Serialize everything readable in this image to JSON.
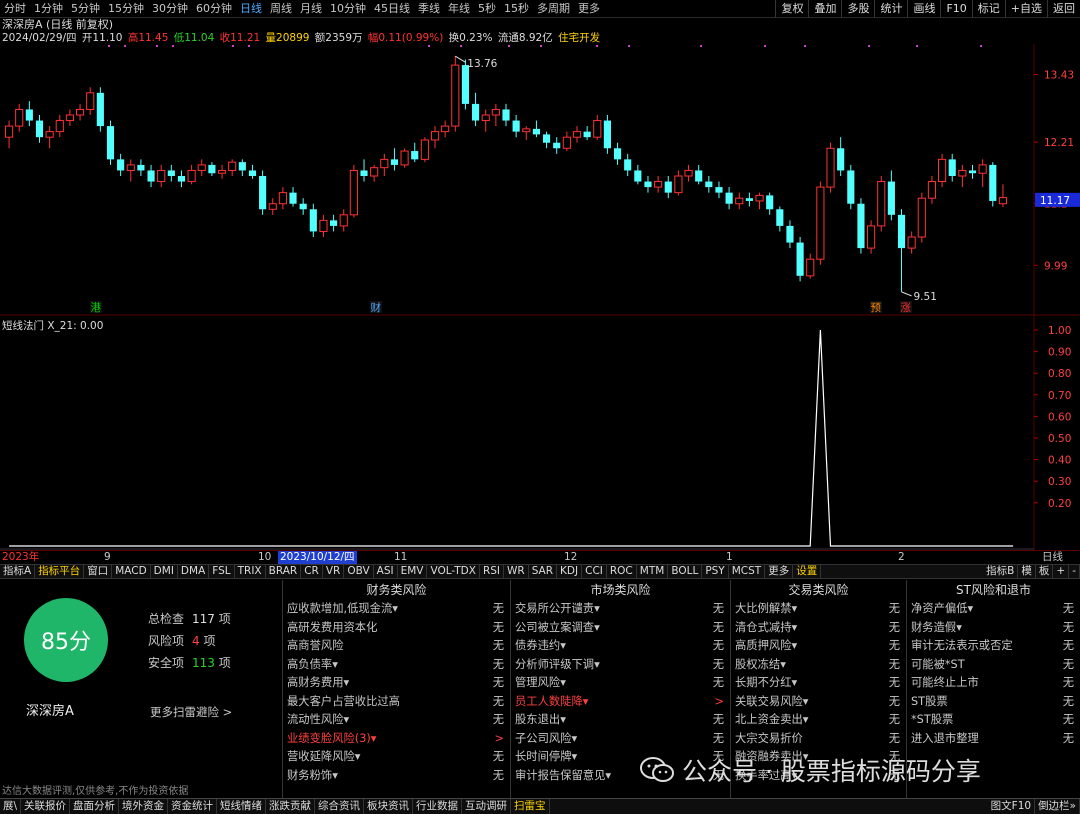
{
  "top_tabs": [
    "分时",
    "1分钟",
    "5分钟",
    "15分钟",
    "30分钟",
    "60分钟",
    "日线",
    "周线",
    "月线",
    "10分钟",
    "45日线",
    "季线",
    "年线",
    "5秒",
    "15秒",
    "多周期",
    "更多"
  ],
  "top_active": 6,
  "right_buttons": [
    "复权",
    "叠加",
    "多股",
    "统计",
    "画线",
    "F10",
    "标记",
    "+自选",
    "返回"
  ],
  "title_line": "深深房A (日线 前复权)",
  "quote": {
    "date": "2024/02/29/四",
    "open_label": "开",
    "open": "11.10",
    "high_label": "高",
    "high": "11.45",
    "low_label": "低",
    "low": "11.04",
    "close_label": "收",
    "close": "11.21",
    "vol_label": "量",
    "vol": "20899",
    "amt_label": "额",
    "amt": "2359万",
    "chg_label": "幅",
    "chg": "0.11(0.99%)",
    "turnover_label": "换",
    "turnover": "0.23%",
    "float_label": "流通",
    "float": "8.92亿",
    "sector": "住宅开发"
  },
  "colors": {
    "up": "#ff3232",
    "down": "#54ffff",
    "hl_text": "#4ea8ff",
    "panel_green": "#1fb66a",
    "yellow": "#ffd400"
  },
  "price_axis": {
    "min": 9.4,
    "max": 13.8,
    "ticks": [
      13.43,
      12.21,
      11.1,
      9.99
    ],
    "current": 11.17
  },
  "annotations": {
    "high_label": "13.76",
    "low_label": "9.51"
  },
  "event_markers": [
    {
      "label": "港",
      "color": "#00d000"
    },
    {
      "label": "财",
      "color": "#4ea8ff"
    },
    {
      "label": "预",
      "color": "#ff8800"
    },
    {
      "label": "涨",
      "color": "#ff3030"
    }
  ],
  "osc_title": "短线法门 X_21: 0.00",
  "osc_axis": {
    "min": 0,
    "max": 1,
    "ticks": [
      1.0,
      0.9,
      0.8,
      0.7,
      0.6,
      0.5,
      0.4,
      0.3,
      0.2
    ]
  },
  "chart_data": {
    "type": "candlestick",
    "series": [
      {
        "ohlc": [
          [
            12.3,
            12.6,
            12.1,
            12.5
          ],
          [
            12.5,
            12.9,
            12.4,
            12.8
          ],
          [
            12.8,
            12.95,
            12.5,
            12.6
          ],
          [
            12.6,
            12.7,
            12.2,
            12.3
          ],
          [
            12.3,
            12.5,
            12.1,
            12.4
          ],
          [
            12.4,
            12.7,
            12.3,
            12.6
          ],
          [
            12.6,
            12.8,
            12.5,
            12.7
          ],
          [
            12.7,
            12.9,
            12.6,
            12.8
          ],
          [
            12.8,
            13.2,
            12.7,
            13.1
          ],
          [
            13.1,
            13.2,
            12.4,
            12.5
          ],
          [
            12.5,
            12.6,
            11.8,
            11.9
          ],
          [
            11.9,
            12.0,
            11.6,
            11.7
          ],
          [
            11.7,
            11.9,
            11.5,
            11.8
          ],
          [
            11.8,
            11.9,
            11.6,
            11.7
          ],
          [
            11.7,
            11.8,
            11.4,
            11.5
          ],
          [
            11.5,
            11.8,
            11.4,
            11.7
          ],
          [
            11.7,
            11.8,
            11.5,
            11.6
          ],
          [
            11.6,
            11.7,
            11.4,
            11.5
          ],
          [
            11.5,
            11.8,
            11.45,
            11.7
          ],
          [
            11.7,
            11.9,
            11.6,
            11.8
          ],
          [
            11.8,
            11.85,
            11.6,
            11.65
          ],
          [
            11.65,
            11.8,
            11.55,
            11.7
          ],
          [
            11.7,
            11.9,
            11.6,
            11.85
          ],
          [
            11.85,
            11.9,
            11.6,
            11.7
          ],
          [
            11.7,
            11.8,
            11.55,
            11.6
          ],
          [
            11.6,
            11.7,
            10.9,
            11.0
          ],
          [
            11.0,
            11.2,
            10.9,
            11.1
          ],
          [
            11.1,
            11.4,
            11.0,
            11.3
          ],
          [
            11.3,
            11.4,
            11.05,
            11.1
          ],
          [
            11.1,
            11.2,
            10.9,
            11.0
          ],
          [
            11.0,
            11.1,
            10.5,
            10.6
          ],
          [
            10.6,
            10.9,
            10.5,
            10.8
          ],
          [
            10.8,
            10.9,
            10.6,
            10.7
          ],
          [
            10.7,
            11.0,
            10.6,
            10.9
          ],
          [
            10.9,
            11.8,
            10.85,
            11.7
          ],
          [
            11.7,
            11.9,
            11.5,
            11.6
          ],
          [
            11.6,
            11.8,
            11.5,
            11.75
          ],
          [
            11.75,
            12.0,
            11.6,
            11.9
          ],
          [
            11.9,
            12.1,
            11.7,
            11.8
          ],
          [
            11.8,
            12.1,
            11.75,
            12.05
          ],
          [
            12.05,
            12.2,
            11.85,
            11.9
          ],
          [
            11.9,
            12.3,
            11.85,
            12.25
          ],
          [
            12.25,
            12.5,
            12.1,
            12.4
          ],
          [
            12.4,
            12.6,
            12.3,
            12.5
          ],
          [
            12.5,
            13.76,
            12.4,
            13.6
          ],
          [
            13.6,
            13.7,
            12.8,
            12.9
          ],
          [
            12.9,
            13.1,
            12.5,
            12.6
          ],
          [
            12.6,
            12.8,
            12.4,
            12.7
          ],
          [
            12.7,
            12.9,
            12.5,
            12.8
          ],
          [
            12.8,
            12.9,
            12.5,
            12.6
          ],
          [
            12.6,
            12.7,
            12.3,
            12.4
          ],
          [
            12.4,
            12.5,
            12.25,
            12.45
          ],
          [
            12.45,
            12.6,
            12.3,
            12.35
          ],
          [
            12.35,
            12.4,
            12.1,
            12.2
          ],
          [
            12.2,
            12.3,
            12.0,
            12.1
          ],
          [
            12.1,
            12.4,
            12.05,
            12.3
          ],
          [
            12.3,
            12.5,
            12.2,
            12.4
          ],
          [
            12.4,
            12.5,
            12.25,
            12.3
          ],
          [
            12.3,
            12.7,
            12.25,
            12.6
          ],
          [
            12.6,
            12.7,
            12.0,
            12.1
          ],
          [
            12.1,
            12.2,
            11.8,
            11.9
          ],
          [
            11.9,
            12.0,
            11.6,
            11.7
          ],
          [
            11.7,
            11.8,
            11.45,
            11.5
          ],
          [
            11.5,
            11.6,
            11.3,
            11.4
          ],
          [
            11.4,
            11.6,
            11.3,
            11.5
          ],
          [
            11.5,
            11.6,
            11.2,
            11.3
          ],
          [
            11.3,
            11.7,
            11.25,
            11.6
          ],
          [
            11.6,
            11.8,
            11.5,
            11.7
          ],
          [
            11.7,
            11.8,
            11.45,
            11.5
          ],
          [
            11.5,
            11.6,
            11.3,
            11.4
          ],
          [
            11.4,
            11.5,
            11.2,
            11.3
          ],
          [
            11.3,
            11.4,
            11.0,
            11.1
          ],
          [
            11.1,
            11.3,
            11.0,
            11.2
          ],
          [
            11.2,
            11.3,
            11.05,
            11.15
          ],
          [
            11.15,
            11.3,
            11.0,
            11.25
          ],
          [
            11.25,
            11.3,
            10.9,
            11.0
          ],
          [
            11.0,
            11.05,
            10.6,
            10.7
          ],
          [
            10.7,
            10.8,
            10.3,
            10.4
          ],
          [
            10.4,
            10.5,
            9.7,
            9.8
          ],
          [
            9.8,
            10.2,
            9.75,
            10.1
          ],
          [
            10.1,
            11.5,
            10.0,
            11.4
          ],
          [
            11.4,
            12.2,
            11.3,
            12.1
          ],
          [
            12.1,
            12.3,
            11.6,
            11.7
          ],
          [
            11.7,
            11.8,
            11.0,
            11.1
          ],
          [
            11.1,
            11.2,
            10.2,
            10.3
          ],
          [
            10.3,
            10.8,
            10.2,
            10.7
          ],
          [
            10.7,
            11.6,
            10.6,
            11.5
          ],
          [
            11.5,
            11.7,
            10.8,
            10.9
          ],
          [
            10.9,
            11.0,
            9.51,
            10.3
          ],
          [
            10.3,
            10.6,
            10.2,
            10.5
          ],
          [
            10.5,
            11.3,
            10.4,
            11.2
          ],
          [
            11.2,
            11.6,
            11.1,
            11.5
          ],
          [
            11.5,
            12.0,
            11.4,
            11.9
          ],
          [
            11.9,
            12.0,
            11.5,
            11.6
          ],
          [
            11.6,
            11.8,
            11.4,
            11.7
          ],
          [
            11.7,
            11.8,
            11.55,
            11.65
          ],
          [
            11.65,
            11.9,
            11.4,
            11.8
          ],
          [
            11.8,
            11.85,
            11.05,
            11.15
          ],
          [
            11.1,
            11.45,
            11.04,
            11.21
          ]
        ],
        "x21": [
          0,
          0,
          0,
          0,
          0,
          0,
          0,
          0,
          0,
          0,
          0,
          0,
          0,
          0,
          0,
          0,
          0,
          0,
          0,
          0,
          0,
          0,
          0,
          0,
          0,
          0,
          0,
          0,
          0,
          0,
          0,
          0,
          0,
          0,
          0,
          0,
          0,
          0,
          0,
          0,
          0,
          0,
          0,
          0,
          0,
          0,
          0,
          0,
          0,
          0,
          0,
          0,
          0,
          0,
          0,
          0,
          0,
          0,
          0,
          0,
          0,
          0,
          0,
          0,
          0,
          0,
          0,
          0,
          0,
          0,
          0,
          0,
          0,
          0,
          0,
          0,
          0,
          0,
          0,
          0,
          1,
          0,
          0,
          0,
          0,
          0,
          0,
          0,
          0,
          0,
          0,
          0,
          0,
          0,
          0,
          0,
          0,
          0,
          0,
          0
        ]
      }
    ],
    "ylim": [
      9.4,
      13.8
    ]
  },
  "date_labels": [
    {
      "text": "2023年",
      "color": "#ff3232"
    },
    {
      "text": "9",
      "color": "#c8c8c8"
    },
    {
      "text": "10",
      "color": "#c8c8c8"
    },
    {
      "text": "2023/10/12/四",
      "color": "#ffffff",
      "bg": "#1f3fd0"
    },
    {
      "text": "11",
      "color": "#c8c8c8"
    },
    {
      "text": "12",
      "color": "#c8c8c8"
    },
    {
      "text": "1",
      "color": "#c8c8c8"
    },
    {
      "text": "2",
      "color": "#c8c8c8"
    },
    {
      "text": "日线",
      "color": "#c8c8c8"
    }
  ],
  "indicator_tabs": [
    "指标A",
    "指标平台",
    "窗口",
    "MACD",
    "DMI",
    "DMA",
    "FSL",
    "TRIX",
    "BRAR",
    "CR",
    "VR",
    "OBV",
    "ASI",
    "EMV",
    "VOL-TDX",
    "RSI",
    "WR",
    "SAR",
    "KDJ",
    "CCI",
    "ROC",
    "MTM",
    "BOLL",
    "PSY",
    "MCST",
    "更多",
    "设置"
  ],
  "indicator_right": [
    "指标B",
    "模",
    "板",
    "+",
    "-"
  ],
  "scan": {
    "score": "85分",
    "stock_name": "深深房A",
    "total_label": "总检查",
    "total_value": "117",
    "total_unit": "项",
    "risk_label": "风险项",
    "risk_value": "4",
    "risk_unit": "项",
    "safe_label": "安全项",
    "safe_value": "113",
    "safe_unit": "项",
    "more_link": "更多扫雷避险 >",
    "disclaimer": "达信大数据评测,仅供参考,不作为投资依据"
  },
  "risk_columns": [
    {
      "title": "财务类风险",
      "rows": [
        {
          "label": "应收款增加,低现金流▾",
          "value": "无"
        },
        {
          "label": "高研发费用资本化",
          "value": "无"
        },
        {
          "label": "高商誉风险",
          "value": "无"
        },
        {
          "label": "高负债率▾",
          "value": "无"
        },
        {
          "label": "高财务费用▾",
          "value": "无"
        },
        {
          "label": "最大客户占营收比过高",
          "value": "无"
        },
        {
          "label": "流动性风险▾",
          "value": "无"
        },
        {
          "label": "业绩变脸风险(3)▾",
          "value": ">",
          "red": true
        },
        {
          "label": "营收延降风险▾",
          "value": "无"
        },
        {
          "label": "财务粉饰▾",
          "value": "无"
        }
      ]
    },
    {
      "title": "市场类风险",
      "rows": [
        {
          "label": "交易所公开谴责▾",
          "value": "无"
        },
        {
          "label": "公司被立案调查▾",
          "value": "无"
        },
        {
          "label": "债券违约▾",
          "value": "无"
        },
        {
          "label": "分析师评级下调▾",
          "value": "无"
        },
        {
          "label": "管理风险▾",
          "value": "无"
        },
        {
          "label": "员工人数陡降▾",
          "value": ">",
          "red": true
        },
        {
          "label": "股东退出▾",
          "value": "无"
        },
        {
          "label": "子公司风险▾",
          "value": "无"
        },
        {
          "label": "长时间停牌▾",
          "value": "无"
        },
        {
          "label": "审计报告保留意见▾",
          "value": "无"
        }
      ]
    },
    {
      "title": "交易类风险",
      "rows": [
        {
          "label": "大比例解禁▾",
          "value": "无"
        },
        {
          "label": "清仓式减持▾",
          "value": "无"
        },
        {
          "label": "高质押风险▾",
          "value": "无"
        },
        {
          "label": "股权冻结▾",
          "value": "无"
        },
        {
          "label": "长期不分红▾",
          "value": "无"
        },
        {
          "label": "关联交易风险▾",
          "value": "无"
        },
        {
          "label": "北上资金卖出▾",
          "value": "无"
        },
        {
          "label": "大宗交易折价",
          "value": "无"
        },
        {
          "label": "融资融券卖出▾",
          "value": "无"
        },
        {
          "label": "换手率过高▾",
          "value": "无"
        }
      ]
    },
    {
      "title": "ST风险和退市",
      "rows": [
        {
          "label": "净资产偏低▾",
          "value": "无"
        },
        {
          "label": "财务造假▾",
          "value": "无"
        },
        {
          "label": "审计无法表示或否定",
          "value": "无"
        },
        {
          "label": "可能被*ST",
          "value": "无"
        },
        {
          "label": "可能终止上市",
          "value": "无"
        },
        {
          "label": "ST股票",
          "value": "无"
        },
        {
          "label": "*ST股票",
          "value": "无"
        },
        {
          "label": "进入退市整理",
          "value": "无"
        }
      ]
    }
  ],
  "bottom_tabs": [
    "展\\",
    "关联报价",
    "盘面分析",
    "境外资金",
    "资金统计",
    "短线情绪",
    "涨跌贡献",
    "综合资讯",
    "板块资讯",
    "行业数据",
    "互动调研",
    "扫雷宝"
  ],
  "bottom_active": 11,
  "bottom_right": [
    "图文F10",
    "倒边栏»"
  ],
  "watermark": "公众号 · 股票指标源码分享"
}
